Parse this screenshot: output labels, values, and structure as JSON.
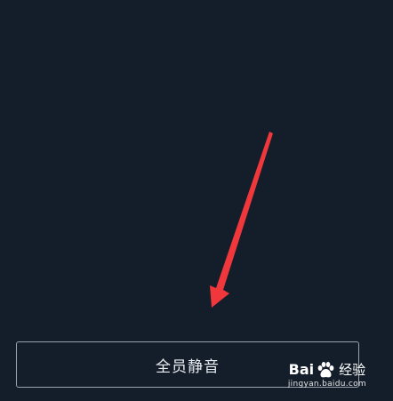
{
  "mute_all_label": "全员静音",
  "arrow_color": "#f0383c",
  "watermark": {
    "brand_left": "Bai",
    "brand_right": "经验",
    "url": "jingyan.baidu.com",
    "logo_icon": "baidu-paw-icon"
  }
}
